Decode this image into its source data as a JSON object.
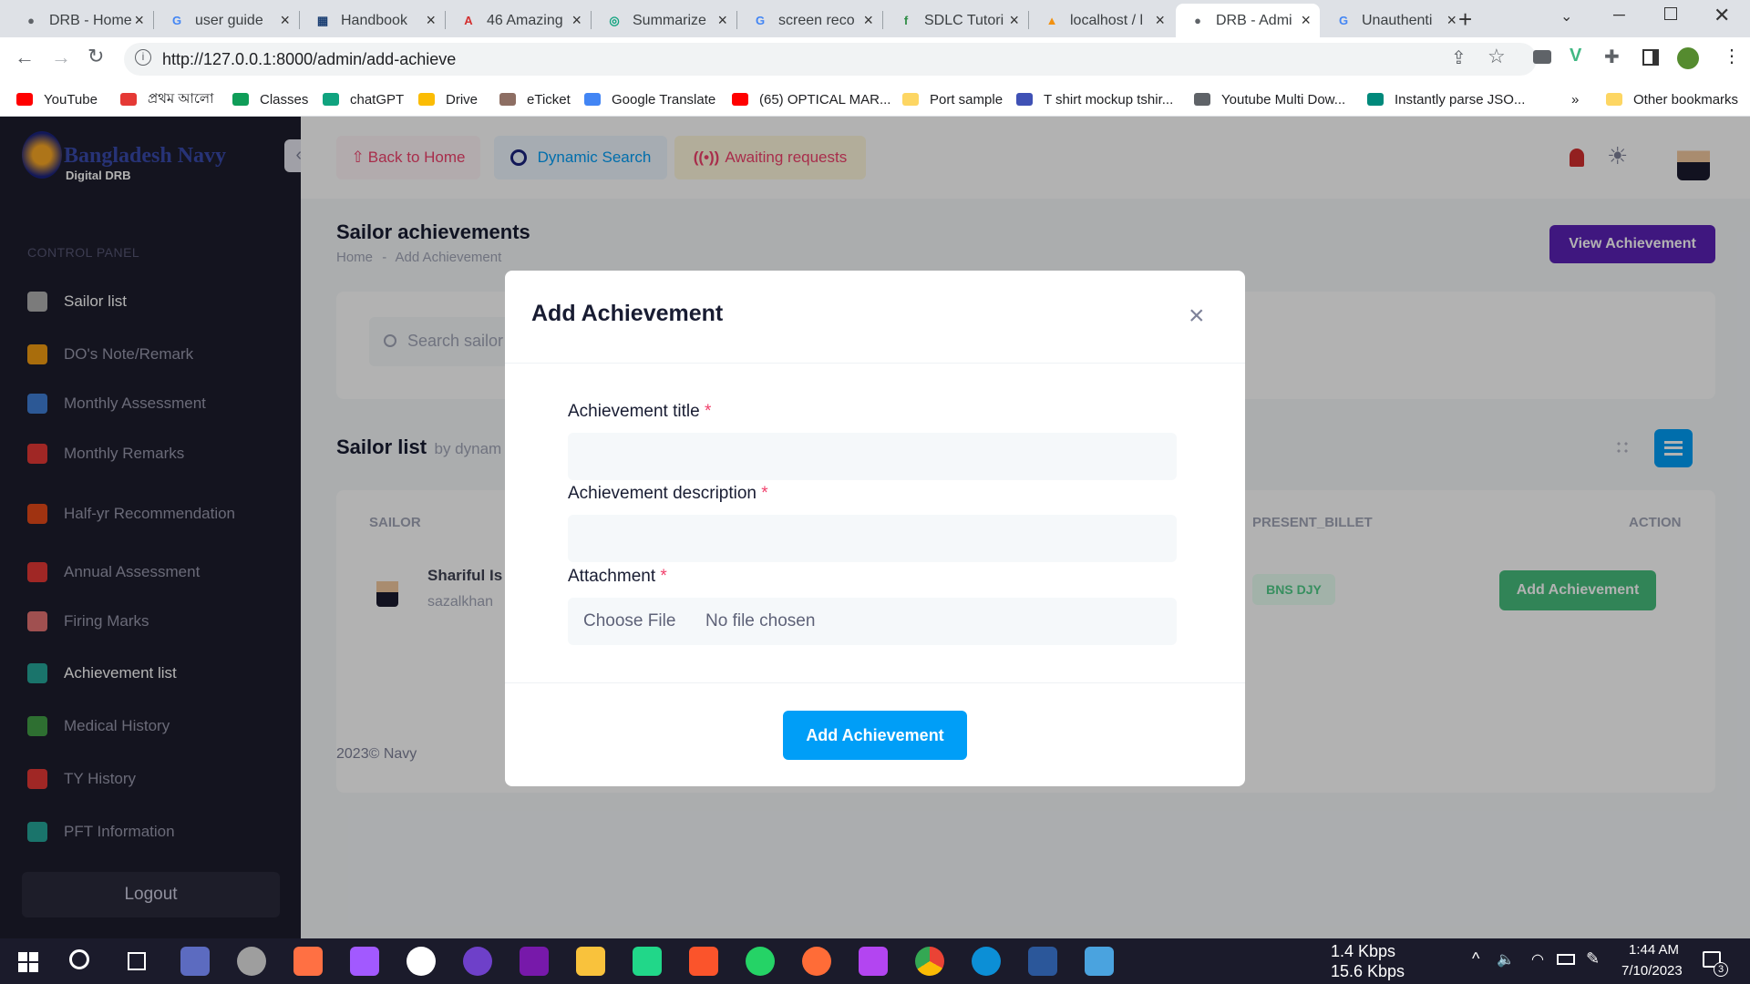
{
  "browser": {
    "tabs": [
      {
        "title": "DRB - Home",
        "color": "#5f6368",
        "glyph": "●"
      },
      {
        "title": "user guide",
        "color": "#4285f4",
        "glyph": "G"
      },
      {
        "title": "Handbook",
        "color": "#1a3e72",
        "glyph": "▦"
      },
      {
        "title": "46 Amazing",
        "color": "#d32f2f",
        "glyph": "A"
      },
      {
        "title": "Summarize",
        "color": "#10a37f",
        "glyph": "◎"
      },
      {
        "title": "screen reco",
        "color": "#4285f4",
        "glyph": "G"
      },
      {
        "title": "SDLC Tutori",
        "color": "#2f8d46",
        "glyph": "f"
      },
      {
        "title": "localhost / l",
        "color": "#f29111",
        "glyph": "▲"
      },
      {
        "title": "DRB - Admi",
        "color": "#5f6368",
        "glyph": "●"
      },
      {
        "title": "Unauthenti",
        "color": "#4285f4",
        "glyph": "G"
      }
    ],
    "new_tab": "+",
    "url": "http://127.0.0.1:8000/admin/add-achieve",
    "bookmarks": [
      {
        "label": "YouTube",
        "color": "#ff0000"
      },
      {
        "label": "প্রথম আলো",
        "color": "#e53935"
      },
      {
        "label": "Classes",
        "color": "#0f9d58"
      },
      {
        "label": "chatGPT",
        "color": "#10a37f"
      },
      {
        "label": "Drive",
        "color": "#fbbc04"
      },
      {
        "label": "eTicket",
        "color": "#8d6e63"
      },
      {
        "label": "Google Translate",
        "color": "#4285f4"
      },
      {
        "label": "(65) OPTICAL MAR...",
        "color": "#ff0000"
      },
      {
        "label": "Port sample",
        "color": "#fdd663"
      },
      {
        "label": "T shirt mockup tshir...",
        "color": "#3f51b5"
      },
      {
        "label": "Youtube Multi Dow...",
        "color": "#5f6368"
      },
      {
        "label": "Instantly parse JSO...",
        "color": "#00897b"
      }
    ],
    "more_bookmarks": "»",
    "other_bookmarks": "Other bookmarks"
  },
  "sidebar": {
    "logo_title": "Bangladesh Navy",
    "logo_subtitle": "Digital DRB",
    "section": "CONTROL PANEL",
    "items": [
      {
        "label": "Sailor list",
        "icon_color": "#b0b0b0",
        "active": true
      },
      {
        "label": "DO's Note/Remark",
        "icon_color": "#f39c12",
        "active": false
      },
      {
        "label": "Monthly Assessment",
        "icon_color": "#3f7fd6",
        "active": false
      },
      {
        "label": "Monthly Remarks",
        "icon_color": "#e53935",
        "active": false
      },
      {
        "label": "Half-yr Recommendation",
        "icon_color": "#e64a19",
        "active": false
      },
      {
        "label": "Annual Assessment",
        "icon_color": "#e53935",
        "active": false
      },
      {
        "label": "Firing Marks",
        "icon_color": "#e57373",
        "active": false
      },
      {
        "label": "Achievement list",
        "icon_color": "#26a69a",
        "active": true
      },
      {
        "label": "Medical History",
        "icon_color": "#43a047",
        "active": false
      },
      {
        "label": "TY History",
        "icon_color": "#e53935",
        "active": false
      },
      {
        "label": "PFT Information",
        "icon_color": "#26a69a",
        "active": false
      }
    ],
    "logout": "Logout"
  },
  "header": {
    "back_home": "Back to Home",
    "dynamic_search": "Dynamic Search",
    "awaiting": "Awaiting requests"
  },
  "content": {
    "title": "Sailor achievements",
    "breadcrumb_home": "Home",
    "breadcrumb_sep": "-",
    "breadcrumb_current": "Add Achievement",
    "view_button": "View Achievement",
    "search_placeholder": "Search sailor",
    "list_title": "Sailor list",
    "list_sub": "by dynam",
    "columns": {
      "sailor": "SAILOR",
      "billet": "PRESENT_BILLET",
      "action": "ACTION"
    },
    "row": {
      "name": "Shariful Is",
      "email": "sazalkhan",
      "billet": "BNS DJY",
      "action": "Add Achievement"
    },
    "footer": "2023© Navy"
  },
  "modal": {
    "title": "Add Achievement",
    "close": "×",
    "field_title_label": "Achievement title",
    "field_desc_label": "Achievement description",
    "field_attach_label": "Attachment",
    "required_mark": "*",
    "choose_file": "Choose File",
    "no_file": "No file chosen",
    "submit": "Add Achievement"
  },
  "taskbar": {
    "net_down": "1.4 Kbps",
    "net_up": "15.6 Kbps",
    "time": "1:44 AM",
    "date": "7/10/2023",
    "notif_count": "3"
  },
  "colors": {
    "primary": "#009ef7",
    "purple": "#5b21b6",
    "success": "#47be7d",
    "sidebar_bg": "#1e1e2d",
    "danger": "#f1416c"
  }
}
